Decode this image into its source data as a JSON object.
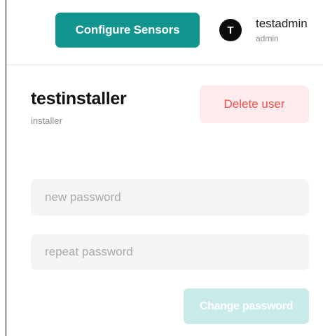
{
  "header": {
    "configure_label": "Configure Sensors",
    "current_user": {
      "initial": "T",
      "name": "testadmin",
      "role": "admin"
    }
  },
  "user": {
    "name": "testinstaller",
    "role": "installer",
    "delete_label": "Delete user"
  },
  "password_form": {
    "new_placeholder": "new password",
    "new_value": "",
    "repeat_placeholder": "repeat password",
    "repeat_value": "",
    "submit_label": "Change password"
  },
  "colors": {
    "accent": "#12958f",
    "accent_disabled": "#c8ebe9",
    "danger_text": "#f04e4e",
    "danger_bg": "#fdeceb"
  }
}
